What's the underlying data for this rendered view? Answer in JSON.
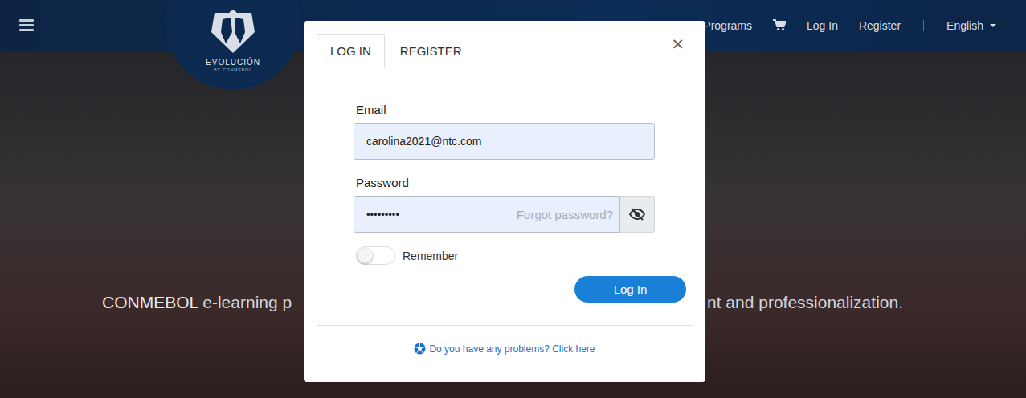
{
  "header": {
    "logo": {
      "title": "-EVOLUCIÓN-",
      "subtitle": "BY CONMEBOL"
    },
    "nav": [
      "Programs"
    ],
    "account": [
      "Log In",
      "Register"
    ],
    "language": "English"
  },
  "hero": {
    "brand": "CONMEBOL",
    "left": " e-learning p",
    "right": "nt and professionalization."
  },
  "modal": {
    "close": "×",
    "tabs": [
      {
        "label": "LOG IN",
        "selected": true
      },
      {
        "label": "REGISTER",
        "selected": false
      }
    ],
    "email": {
      "label": "Email",
      "value": "carolina2021@ntc.com"
    },
    "password": {
      "label": "Password",
      "value": "•••••••••",
      "masked": true,
      "link": "Forgot password?"
    },
    "remember": {
      "label": "Remember",
      "on": false
    },
    "button": "Log In",
    "help": "Do you have any problems? Click here"
  }
}
